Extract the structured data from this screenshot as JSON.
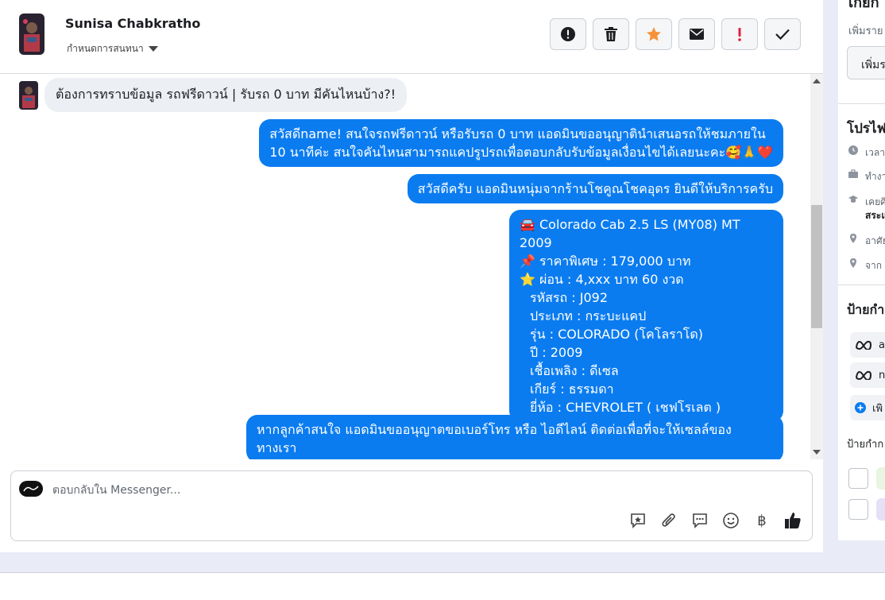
{
  "header": {
    "contact_name": "Sunisa Chabkratho",
    "conversation_settings_label": "กำหนดการสนทนา",
    "actions": [
      {
        "icon": "alert-circle-icon",
        "name": "report-button",
        "color": "#1c1e21"
      },
      {
        "icon": "trash-icon",
        "name": "delete-button",
        "color": "#1c1e21"
      },
      {
        "icon": "star-icon",
        "name": "star-button",
        "color": "#f7923a"
      },
      {
        "icon": "envelope-icon",
        "name": "mark-unread-button",
        "color": "#1c1e21"
      },
      {
        "icon": "exclamation-icon",
        "name": "follow-up-button",
        "color": "#e41e3f"
      },
      {
        "icon": "checkmark-icon",
        "name": "mark-done-button",
        "color": "#1c1e21"
      }
    ]
  },
  "messages": {
    "incoming": "ต้องการทราบข้อมูล รถฟรีดาวน์ | รับรถ 0 บาท มีคันไหนบ้าง?!",
    "reply1": [
      "สวัสดีname! สนใจรถฟรีดาวน์ หรือรับรถ 0 บาท แอดมินขออนุญาตินำเสนอรถให้ชมภายใน",
      "10 นาทีค่ะ สนใจคันไหนสามารถแคปรูปรถเพื่อตอบกลับรับข้อมูลเงื่อนไขได้เลยนะคะ🥰🙏❤️"
    ],
    "reply2": "สวัสดีครับ แอดมินหนุ่มจากร้านโชคูณโชคอุดร ยินดีให้บริการครับ",
    "car_card": [
      "🚘 Colorado Cab 2.5 LS (MY08) MT 2009",
      "📌 ราคาพิเศษ : 179,000 บาท",
      "⭐ ผ่อน : 4,xxx บาท 60 งวด",
      "รหัสรถ : J092",
      "ประเภท : กระบะแคป",
      "รุ่น : COLORADO (โคโลราโด)",
      "ปี : 2009",
      "เชื้อเพลิง : ดีเซล",
      "เกียร์ : ธรรมดา",
      "ยี่ห้อ : CHEVROLET ( เชฟโรเลต )"
    ],
    "reply3": [
      "หากลูกค้าสนใจ แอดมินขออนุญาตขอเบอร์โทร หรือ ไอดีไลน์ ติดต่อเพื่อที่จะให้เซลล์ของ",
      "ทางเรา"
    ]
  },
  "composer": {
    "placeholder": "ตอบกลับใน Messenger...",
    "tools": [
      "saved-reply-icon",
      "attachment-icon",
      "chat-bubble-icon",
      "emoji-icon",
      "baht-icon",
      "thumbs-up-icon"
    ],
    "baht_symbol": "฿"
  },
  "right_panel": {
    "top_text": "เกยก",
    "add_label": "เพิ่มราย",
    "add_button": "เพิ่มร",
    "profile_title": "โปรไฟ",
    "details": [
      {
        "icon": "clock-icon",
        "text": "เวลา"
      },
      {
        "icon": "briefcase-icon",
        "text": "ทำงา"
      },
      {
        "icon": "graduation-cap-icon",
        "text": "เคยศึ"
      },
      {
        "icon": "pin-icon",
        "text": "อาศัย"
      },
      {
        "icon": "pin-icon",
        "text": "จาก"
      }
    ],
    "details_extra": "สระแ",
    "labels_title": "ป้ายกำ",
    "tags": [
      {
        "icon": "meta-icon",
        "text": "a"
      },
      {
        "icon": "meta-icon",
        "text": "n"
      }
    ],
    "add_tag": "เพิ",
    "labels_title2": "ป้ายกำก",
    "colors": {
      "accent": "#0b7cf0",
      "chip1": "#e8f5e0",
      "chip2": "#e6e0f7"
    }
  }
}
